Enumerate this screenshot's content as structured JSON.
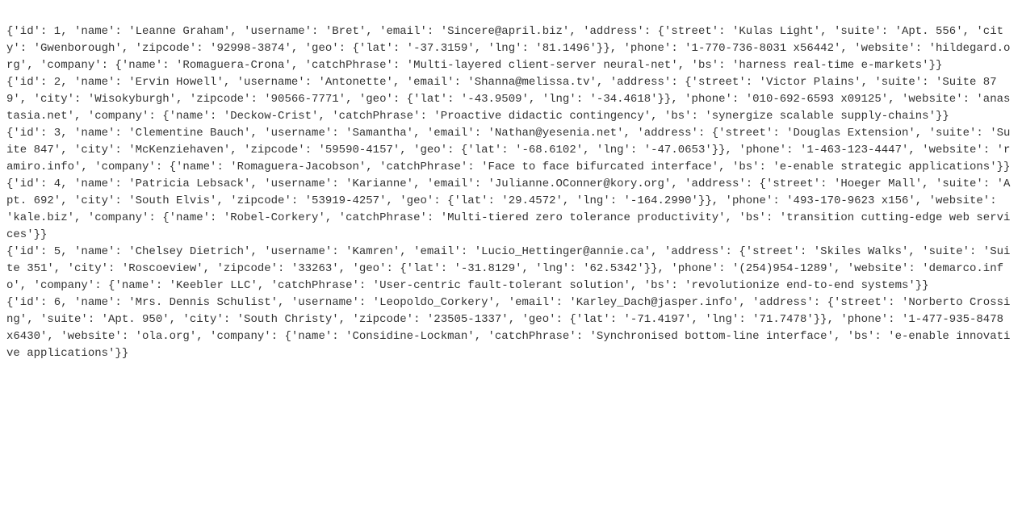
{
  "records": [
    "{'id': 1, 'name': 'Leanne Graham', 'username': 'Bret', 'email': 'Sincere@april.biz', 'address': {'street': 'Kulas Light', 'suite': 'Apt. 556', 'city': 'Gwenborough', 'zipcode': '92998-3874', 'geo': {'lat': '-37.3159', 'lng': '81.1496'}}, 'phone': '1-770-736-8031 x56442', 'website': 'hildegard.org', 'company': {'name': 'Romaguera-Crona', 'catchPhrase': 'Multi-layered client-server neural-net', 'bs': 'harness real-time e-markets'}}",
    "{'id': 2, 'name': 'Ervin Howell', 'username': 'Antonette', 'email': 'Shanna@melissa.tv', 'address': {'street': 'Victor Plains', 'suite': 'Suite 879', 'city': 'Wisokyburgh', 'zipcode': '90566-7771', 'geo': {'lat': '-43.9509', 'lng': '-34.4618'}}, 'phone': '010-692-6593 x09125', 'website': 'anastasia.net', 'company': {'name': 'Deckow-Crist', 'catchPhrase': 'Proactive didactic contingency', 'bs': 'synergize scalable supply-chains'}}",
    "{'id': 3, 'name': 'Clementine Bauch', 'username': 'Samantha', 'email': 'Nathan@yesenia.net', 'address': {'street': 'Douglas Extension', 'suite': 'Suite 847', 'city': 'McKenziehaven', 'zipcode': '59590-4157', 'geo': {'lat': '-68.6102', 'lng': '-47.0653'}}, 'phone': '1-463-123-4447', 'website': 'ramiro.info', 'company': {'name': 'Romaguera-Jacobson', 'catchPhrase': 'Face to face bifurcated interface', 'bs': 'e-enable strategic applications'}}",
    "{'id': 4, 'name': 'Patricia Lebsack', 'username': 'Karianne', 'email': 'Julianne.OConner@kory.org', 'address': {'street': 'Hoeger Mall', 'suite': 'Apt. 692', 'city': 'South Elvis', 'zipcode': '53919-4257', 'geo': {'lat': '29.4572', 'lng': '-164.2990'}}, 'phone': '493-170-9623 x156', 'website': 'kale.biz', 'company': {'name': 'Robel-Corkery', 'catchPhrase': 'Multi-tiered zero tolerance productivity', 'bs': 'transition cutting-edge web services'}}",
    "{'id': 5, 'name': 'Chelsey Dietrich', 'username': 'Kamren', 'email': 'Lucio_Hettinger@annie.ca', 'address': {'street': 'Skiles Walks', 'suite': 'Suite 351', 'city': 'Roscoeview', 'zipcode': '33263', 'geo': {'lat': '-31.8129', 'lng': '62.5342'}}, 'phone': '(254)954-1289', 'website': 'demarco.info', 'company': {'name': 'Keebler LLC', 'catchPhrase': 'User-centric fault-tolerant solution', 'bs': 'revolutionize end-to-end systems'}}",
    "{'id': 6, 'name': 'Mrs. Dennis Schulist', 'username': 'Leopoldo_Corkery', 'email': 'Karley_Dach@jasper.info', 'address': {'street': 'Norberto Crossing', 'suite': 'Apt. 950', 'city': 'South Christy', 'zipcode': '23505-1337', 'geo': {'lat': '-71.4197', 'lng': '71.7478'}}, 'phone': '1-477-935-8478 x6430', 'website': 'ola.org', 'company': {'name': 'Considine-Lockman', 'catchPhrase': 'Synchronised bottom-line interface', 'bs': 'e-enable innovative applications'}}"
  ]
}
